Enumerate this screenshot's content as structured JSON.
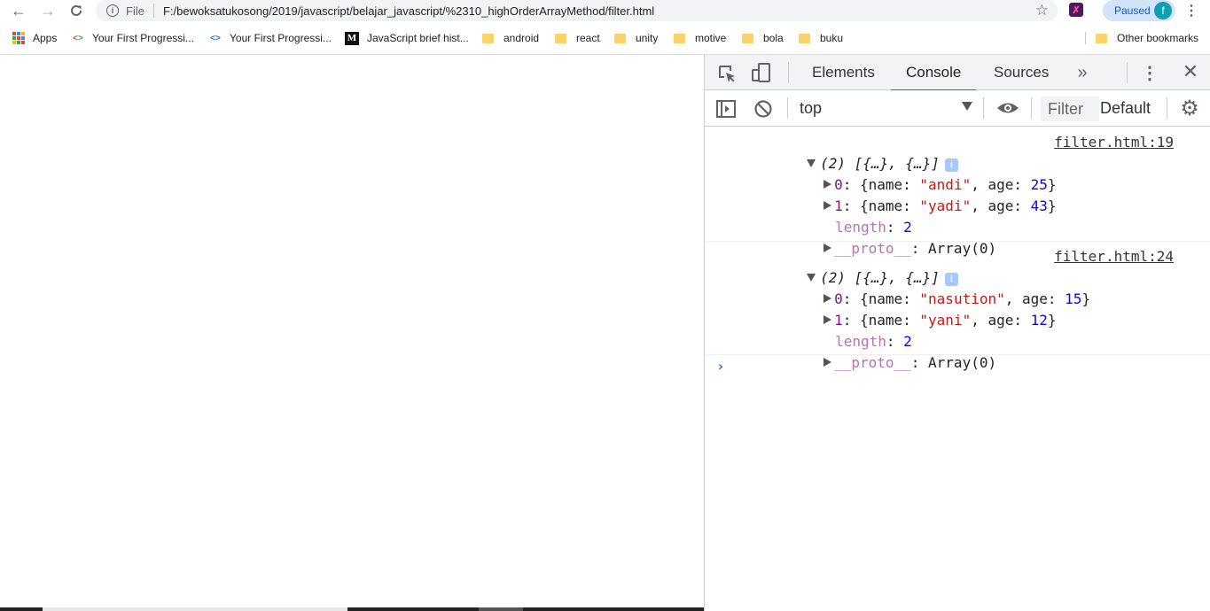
{
  "browser": {
    "scheme": "File",
    "url": "F:/bewoksatukosong/2019/javascript/belajar_javascript/%2310_highOrderArrayMethod/filter.html",
    "profile_status": "Paused",
    "profile_initial": "f",
    "icons": {
      "back": "arrow-left-icon",
      "forward": "arrow-right-icon",
      "reload": "reload-icon",
      "info": "info-icon",
      "star": "star-icon",
      "menu": "kebab-menu-icon"
    }
  },
  "bookmarks": {
    "items": [
      {
        "label": "Apps",
        "icon": "apps-grid-icon"
      },
      {
        "label": "Your First Progressi...",
        "icon": "codelab-icon"
      },
      {
        "label": "Your First Progressi...",
        "icon": "code-icon"
      },
      {
        "label": "JavaScript brief hist...",
        "icon": "medium-icon"
      },
      {
        "label": "android",
        "icon": "folder-icon"
      },
      {
        "label": "react",
        "icon": "folder-icon"
      },
      {
        "label": "unity",
        "icon": "folder-icon"
      },
      {
        "label": "motive",
        "icon": "folder-icon"
      },
      {
        "label": "bola",
        "icon": "folder-icon"
      },
      {
        "label": "buku",
        "icon": "folder-icon"
      }
    ],
    "other": "Other bookmarks"
  },
  "devtools": {
    "tabs": [
      {
        "label": "Elements",
        "active": false
      },
      {
        "label": "Console",
        "active": true
      },
      {
        "label": "Sources",
        "active": false
      }
    ],
    "toolbar": {
      "context": "top",
      "filter_placeholder": "Filter",
      "levels": "Default"
    },
    "accent_color": "#1a73e8"
  },
  "console": {
    "messages": [
      {
        "summary": "(2) [{…}, {…}]",
        "source": "filter.html:19",
        "items": [
          {
            "index": "0",
            "name": "\"andi\"",
            "age": "25"
          },
          {
            "index": "1",
            "name": "\"yadi\"",
            "age": "43"
          }
        ],
        "length_key": "length",
        "length_value": "2",
        "proto_key": "__proto__",
        "proto_value": "Array(0)"
      },
      {
        "summary": "(2) [{…}, {…}]",
        "source": "filter.html:24",
        "items": [
          {
            "index": "0",
            "name": "\"nasution\"",
            "age": "15"
          },
          {
            "index": "1",
            "name": "\"yani\"",
            "age": "12"
          }
        ],
        "length_key": "length",
        "length_value": "2",
        "proto_key": "__proto__",
        "proto_value": "Array(0)"
      }
    ],
    "prompt": "›"
  },
  "syntax": {
    "open_obj": "{name: ",
    "age_key": ", age: ",
    "close_obj": "}",
    "colon": ": "
  }
}
